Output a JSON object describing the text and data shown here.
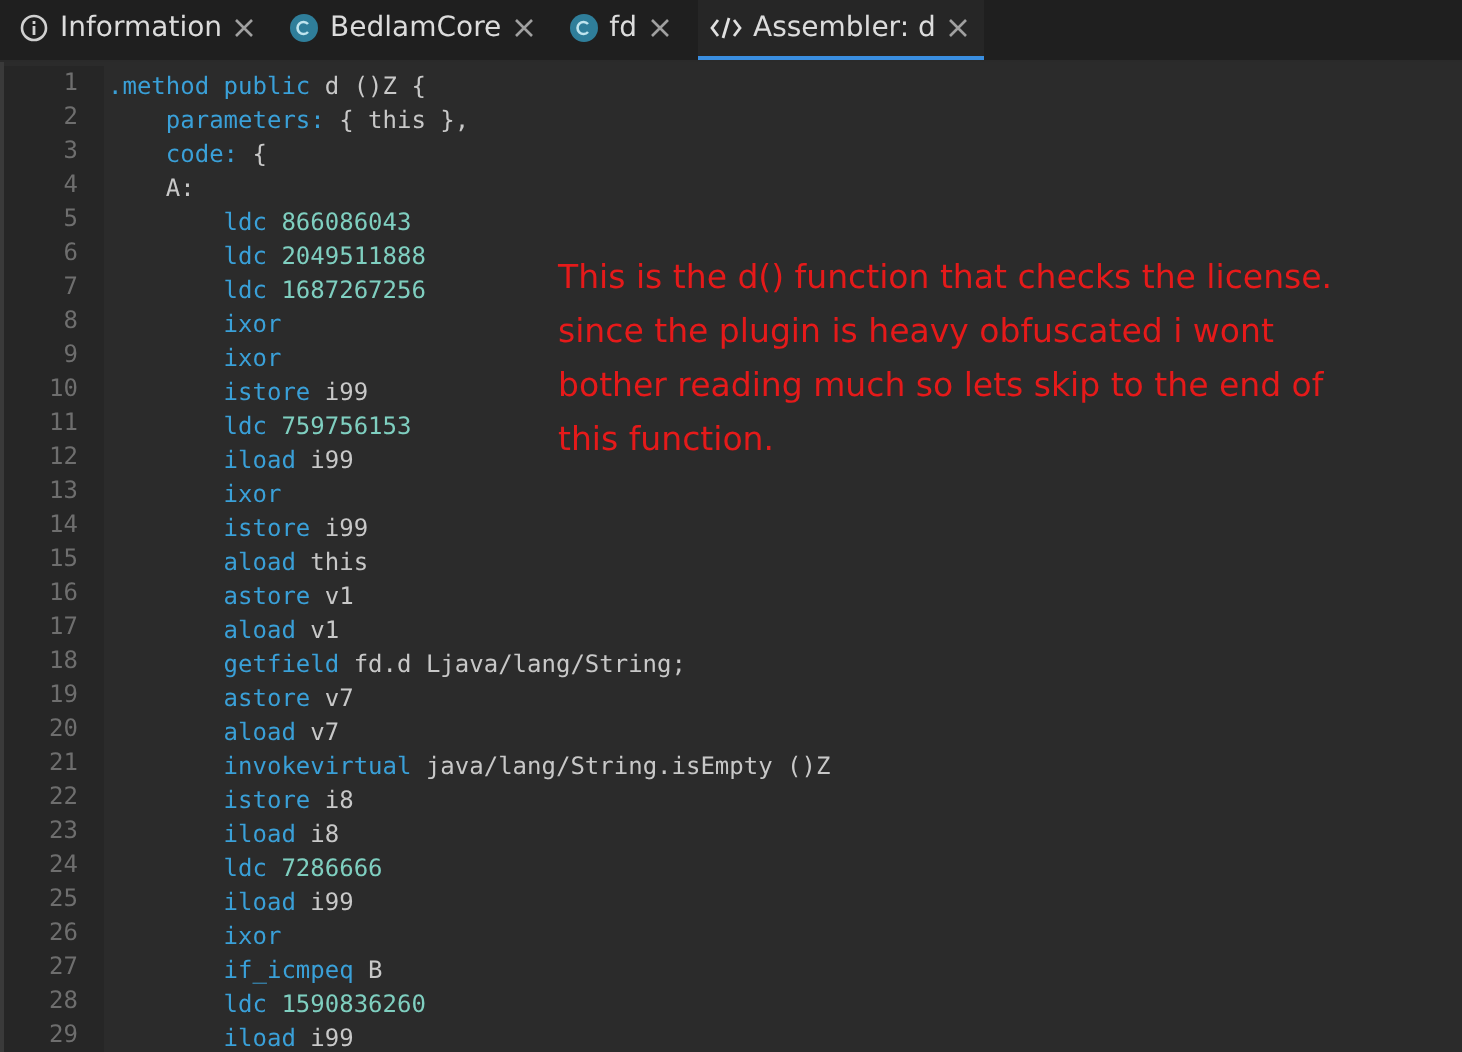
{
  "tabs": [
    {
      "label": "Information",
      "kind": "info",
      "selected": false
    },
    {
      "label": "BedlamCore",
      "kind": "class",
      "selected": false
    },
    {
      "label": "fd",
      "kind": "class",
      "selected": false
    },
    {
      "label": "Assembler: d",
      "kind": "code",
      "selected": true
    }
  ],
  "editor": {
    "lines": [
      {
        "number": "1",
        "tokens": [
          {
            "text": ".method public",
            "kind": "keyword"
          },
          {
            "text": " d ()Z {",
            "kind": "plain"
          }
        ]
      },
      {
        "number": "2",
        "tokens": [
          {
            "text": "    parameters:",
            "kind": "keyword"
          },
          {
            "text": " { this },",
            "kind": "plain"
          }
        ]
      },
      {
        "number": "3",
        "tokens": [
          {
            "text": "    code:",
            "kind": "keyword"
          },
          {
            "text": " {",
            "kind": "plain"
          }
        ]
      },
      {
        "number": "4",
        "tokens": [
          {
            "text": "    A:",
            "kind": "plain"
          }
        ]
      },
      {
        "number": "5",
        "tokens": [
          {
            "text": "        ldc",
            "kind": "keyword"
          },
          {
            "text": " 866086043",
            "kind": "number"
          }
        ]
      },
      {
        "number": "6",
        "tokens": [
          {
            "text": "        ldc",
            "kind": "keyword"
          },
          {
            "text": " 2049511888",
            "kind": "number"
          }
        ]
      },
      {
        "number": "7",
        "tokens": [
          {
            "text": "        ldc",
            "kind": "keyword"
          },
          {
            "text": " 1687267256",
            "kind": "number"
          }
        ]
      },
      {
        "number": "8",
        "tokens": [
          {
            "text": "        ixor",
            "kind": "keyword"
          }
        ]
      },
      {
        "number": "9",
        "tokens": [
          {
            "text": "        ixor",
            "kind": "keyword"
          }
        ]
      },
      {
        "number": "10",
        "tokens": [
          {
            "text": "        istore",
            "kind": "keyword"
          },
          {
            "text": " i99",
            "kind": "plain"
          }
        ]
      },
      {
        "number": "11",
        "tokens": [
          {
            "text": "        ldc",
            "kind": "keyword"
          },
          {
            "text": " 759756153",
            "kind": "number"
          }
        ]
      },
      {
        "number": "12",
        "tokens": [
          {
            "text": "        iload",
            "kind": "keyword"
          },
          {
            "text": " i99",
            "kind": "plain"
          }
        ]
      },
      {
        "number": "13",
        "tokens": [
          {
            "text": "        ixor",
            "kind": "keyword"
          }
        ]
      },
      {
        "number": "14",
        "tokens": [
          {
            "text": "        istore",
            "kind": "keyword"
          },
          {
            "text": " i99",
            "kind": "plain"
          }
        ]
      },
      {
        "number": "15",
        "tokens": [
          {
            "text": "        aload",
            "kind": "keyword"
          },
          {
            "text": " this",
            "kind": "plain"
          }
        ]
      },
      {
        "number": "16",
        "tokens": [
          {
            "text": "        astore",
            "kind": "keyword"
          },
          {
            "text": " v1",
            "kind": "plain"
          }
        ]
      },
      {
        "number": "17",
        "tokens": [
          {
            "text": "        aload",
            "kind": "keyword"
          },
          {
            "text": " v1",
            "kind": "plain"
          }
        ]
      },
      {
        "number": "18",
        "tokens": [
          {
            "text": "        getfield",
            "kind": "keyword"
          },
          {
            "text": " fd.d Ljava/lang/String;",
            "kind": "plain"
          }
        ]
      },
      {
        "number": "19",
        "tokens": [
          {
            "text": "        astore",
            "kind": "keyword"
          },
          {
            "text": " v7",
            "kind": "plain"
          }
        ]
      },
      {
        "number": "20",
        "tokens": [
          {
            "text": "        aload",
            "kind": "keyword"
          },
          {
            "text": " v7",
            "kind": "plain"
          }
        ]
      },
      {
        "number": "21",
        "tokens": [
          {
            "text": "        invokevirtual",
            "kind": "keyword"
          },
          {
            "text": " java/lang/String.isEmpty ()Z",
            "kind": "plain"
          }
        ]
      },
      {
        "number": "22",
        "tokens": [
          {
            "text": "        istore",
            "kind": "keyword"
          },
          {
            "text": " i8",
            "kind": "plain"
          }
        ]
      },
      {
        "number": "23",
        "tokens": [
          {
            "text": "        iload",
            "kind": "keyword"
          },
          {
            "text": " i8",
            "kind": "plain"
          }
        ]
      },
      {
        "number": "24",
        "tokens": [
          {
            "text": "        ldc",
            "kind": "keyword"
          },
          {
            "text": " 7286666",
            "kind": "number"
          }
        ]
      },
      {
        "number": "25",
        "tokens": [
          {
            "text": "        iload",
            "kind": "keyword"
          },
          {
            "text": " i99",
            "kind": "plain"
          }
        ]
      },
      {
        "number": "26",
        "tokens": [
          {
            "text": "        ixor",
            "kind": "keyword"
          }
        ]
      },
      {
        "number": "27",
        "tokens": [
          {
            "text": "        if_icmpeq",
            "kind": "keyword"
          },
          {
            "text": " B",
            "kind": "plain"
          }
        ]
      },
      {
        "number": "28",
        "tokens": [
          {
            "text": "        ldc",
            "kind": "keyword"
          },
          {
            "text": " 1590836260",
            "kind": "number"
          }
        ]
      },
      {
        "number": "29",
        "tokens": [
          {
            "text": "        iload",
            "kind": "keyword"
          },
          {
            "text": " i99",
            "kind": "plain"
          }
        ]
      }
    ]
  },
  "annotation": {
    "lines": [
      "This is the d() function that checks the license.",
      "since the plugin is heavy obfuscated i wont",
      "bother reading much so lets skip to the end of",
      "this function."
    ]
  }
}
